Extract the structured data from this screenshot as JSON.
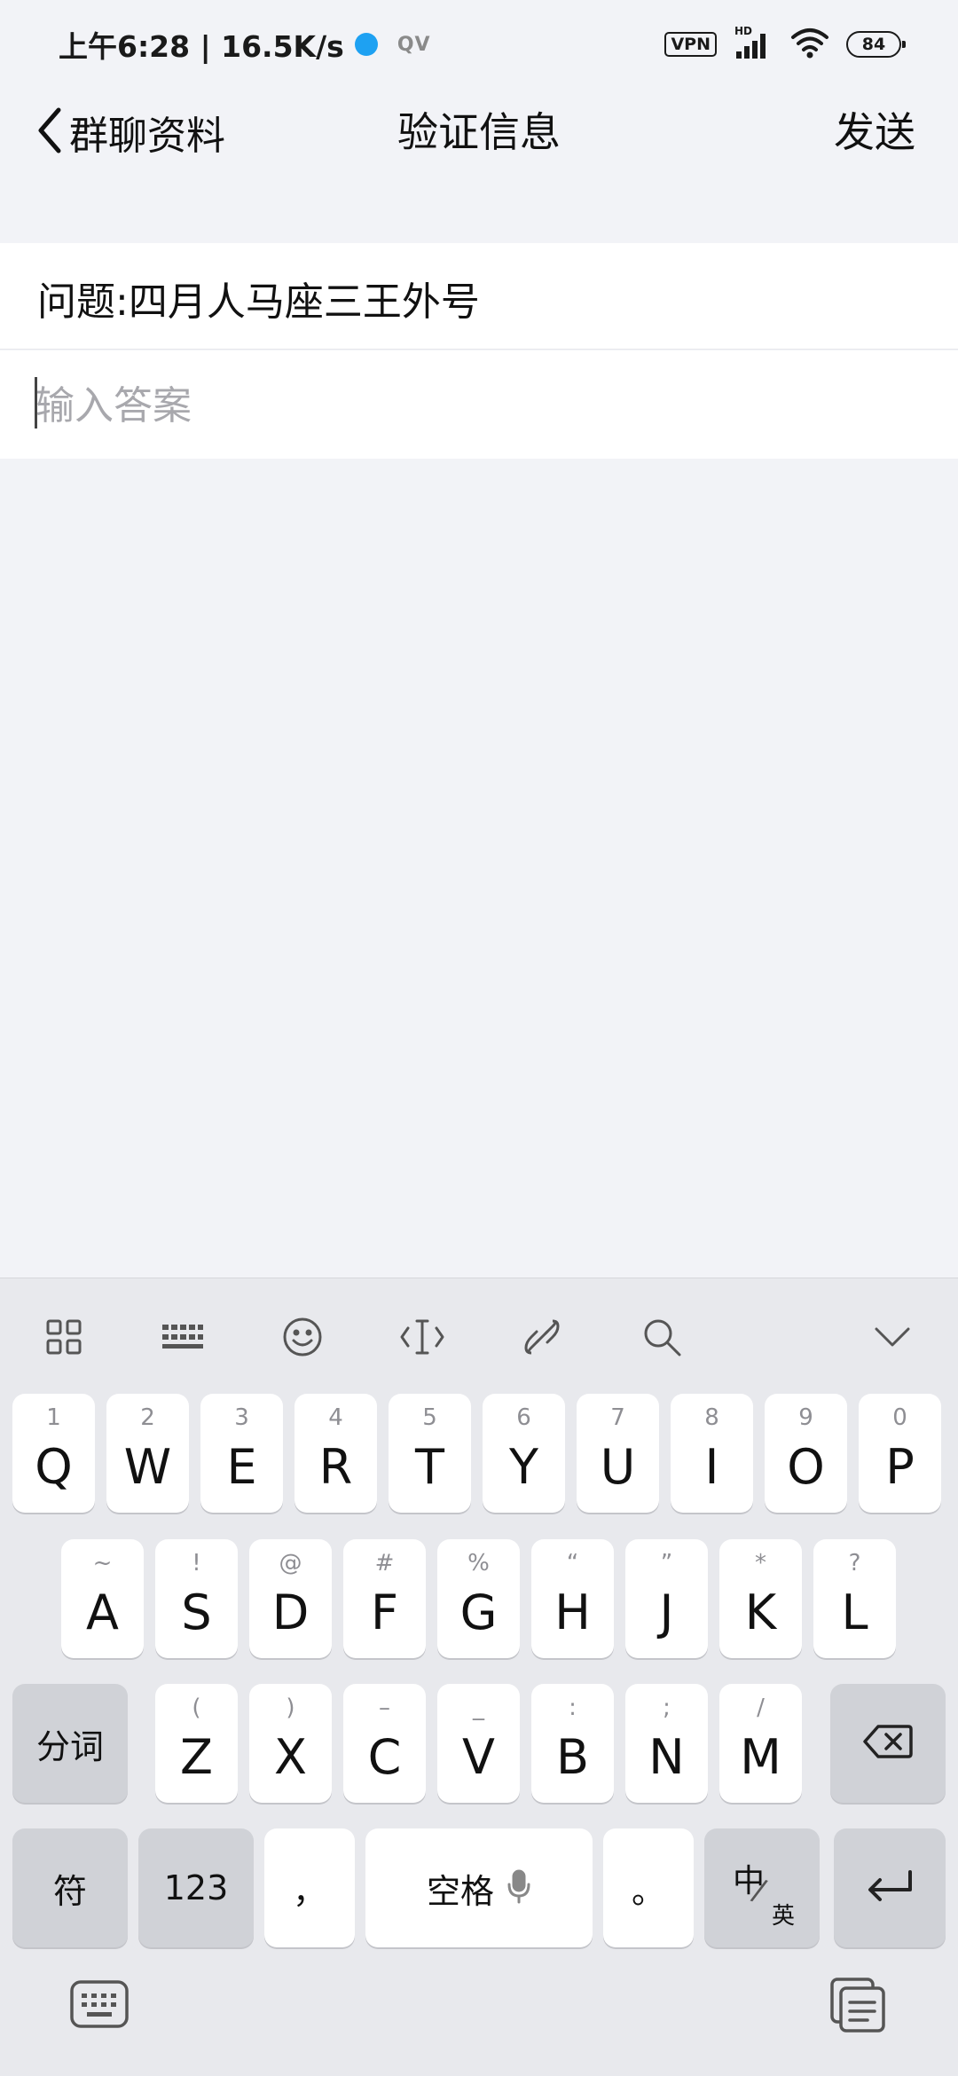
{
  "status_bar": {
    "time_speed": "上午6:28 | 16.5K/s",
    "app_badge": "QV",
    "vpn": "VPN",
    "network": "HD",
    "battery": "84"
  },
  "nav": {
    "back_label": "群聊资料",
    "title": "验证信息",
    "send_label": "发送"
  },
  "form": {
    "question": "问题:四月人马座三王外号",
    "answer_placeholder": "输入答案"
  },
  "keyboard": {
    "row1": [
      {
        "hint": "1",
        "key": "Q"
      },
      {
        "hint": "2",
        "key": "W"
      },
      {
        "hint": "3",
        "key": "E"
      },
      {
        "hint": "4",
        "key": "R"
      },
      {
        "hint": "5",
        "key": "T"
      },
      {
        "hint": "6",
        "key": "Y"
      },
      {
        "hint": "7",
        "key": "U"
      },
      {
        "hint": "8",
        "key": "I"
      },
      {
        "hint": "9",
        "key": "O"
      },
      {
        "hint": "0",
        "key": "P"
      }
    ],
    "row2": [
      {
        "hint": "~",
        "key": "A"
      },
      {
        "hint": "!",
        "key": "S"
      },
      {
        "hint": "@",
        "key": "D"
      },
      {
        "hint": "#",
        "key": "F"
      },
      {
        "hint": "%",
        "key": "G"
      },
      {
        "hint": "“",
        "key": "H"
      },
      {
        "hint": "”",
        "key": "J"
      },
      {
        "hint": "*",
        "key": "K"
      },
      {
        "hint": "?",
        "key": "L"
      }
    ],
    "row3": [
      {
        "hint": "(",
        "key": "Z"
      },
      {
        "hint": ")",
        "key": "X"
      },
      {
        "hint": "–",
        "key": "C"
      },
      {
        "hint": "_",
        "key": "V"
      },
      {
        "hint": ":",
        "key": "B"
      },
      {
        "hint": ";",
        "key": "N"
      },
      {
        "hint": "/",
        "key": "M"
      }
    ],
    "segment_label": "分词",
    "symbol_label": "符",
    "numbers_label": "123",
    "comma_label": "，",
    "space_label": "空格",
    "period_label": "。",
    "lang_main": "中",
    "lang_alt": "英"
  }
}
